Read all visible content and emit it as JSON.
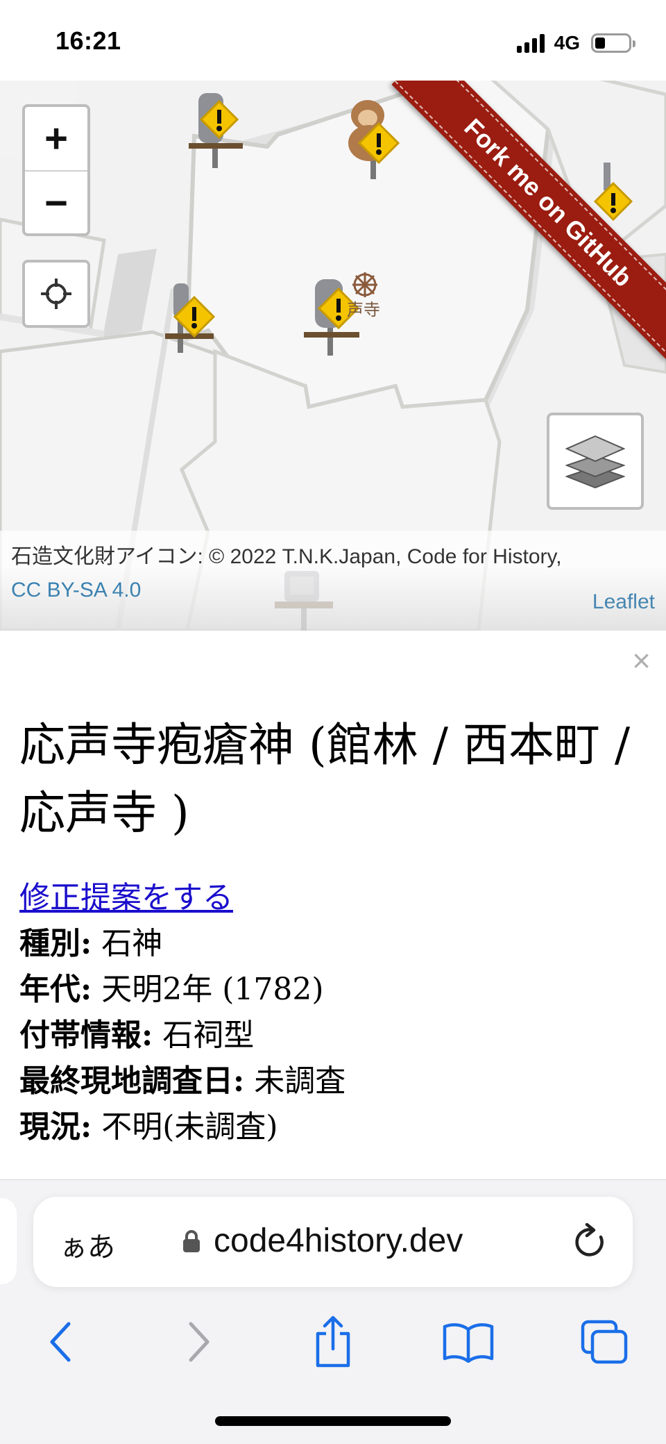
{
  "status_bar": {
    "time": "16:21",
    "network": "4G",
    "battery_percent": 20
  },
  "map": {
    "zoom_in_label": "+",
    "zoom_out_label": "−",
    "temple_label": "声寺",
    "ribbon_text": "Fork me on GitHub",
    "attribution_text": "石造文化財アイコン: © 2022 T.N.K.Japan, Code for History, ",
    "attribution_license": "CC BY-SA 4.0",
    "leaflet_label": "Leaflet",
    "icons": [
      "zoom-in-icon",
      "zoom-out-icon",
      "crosshair-icon",
      "layers-icon",
      "warning-marker-icon",
      "monkey-marker-icon",
      "dharma-wheel-icon"
    ]
  },
  "panel": {
    "close_label": "×",
    "title": "応声寺疱瘡神 (館林 / 西本町 / 応声寺 )",
    "suggest_link": "修正提案をする",
    "rows": [
      {
        "label": "種別:",
        "value": " 石神"
      },
      {
        "label": "年代:",
        "value": " 天明2年 (1782)"
      },
      {
        "label": "付帯情報:",
        "value": " 石祠型"
      },
      {
        "label": "最終現地調査日:",
        "value": " 未調査"
      },
      {
        "label": "現況:",
        "value": " 不明(未調査)"
      }
    ]
  },
  "browser": {
    "aa_label": "ぁあ",
    "url": "code4history.dev",
    "icons": [
      "lock-icon",
      "reload-icon",
      "back-icon",
      "forward-icon",
      "share-icon",
      "bookmarks-icon",
      "tabs-icon"
    ]
  }
}
